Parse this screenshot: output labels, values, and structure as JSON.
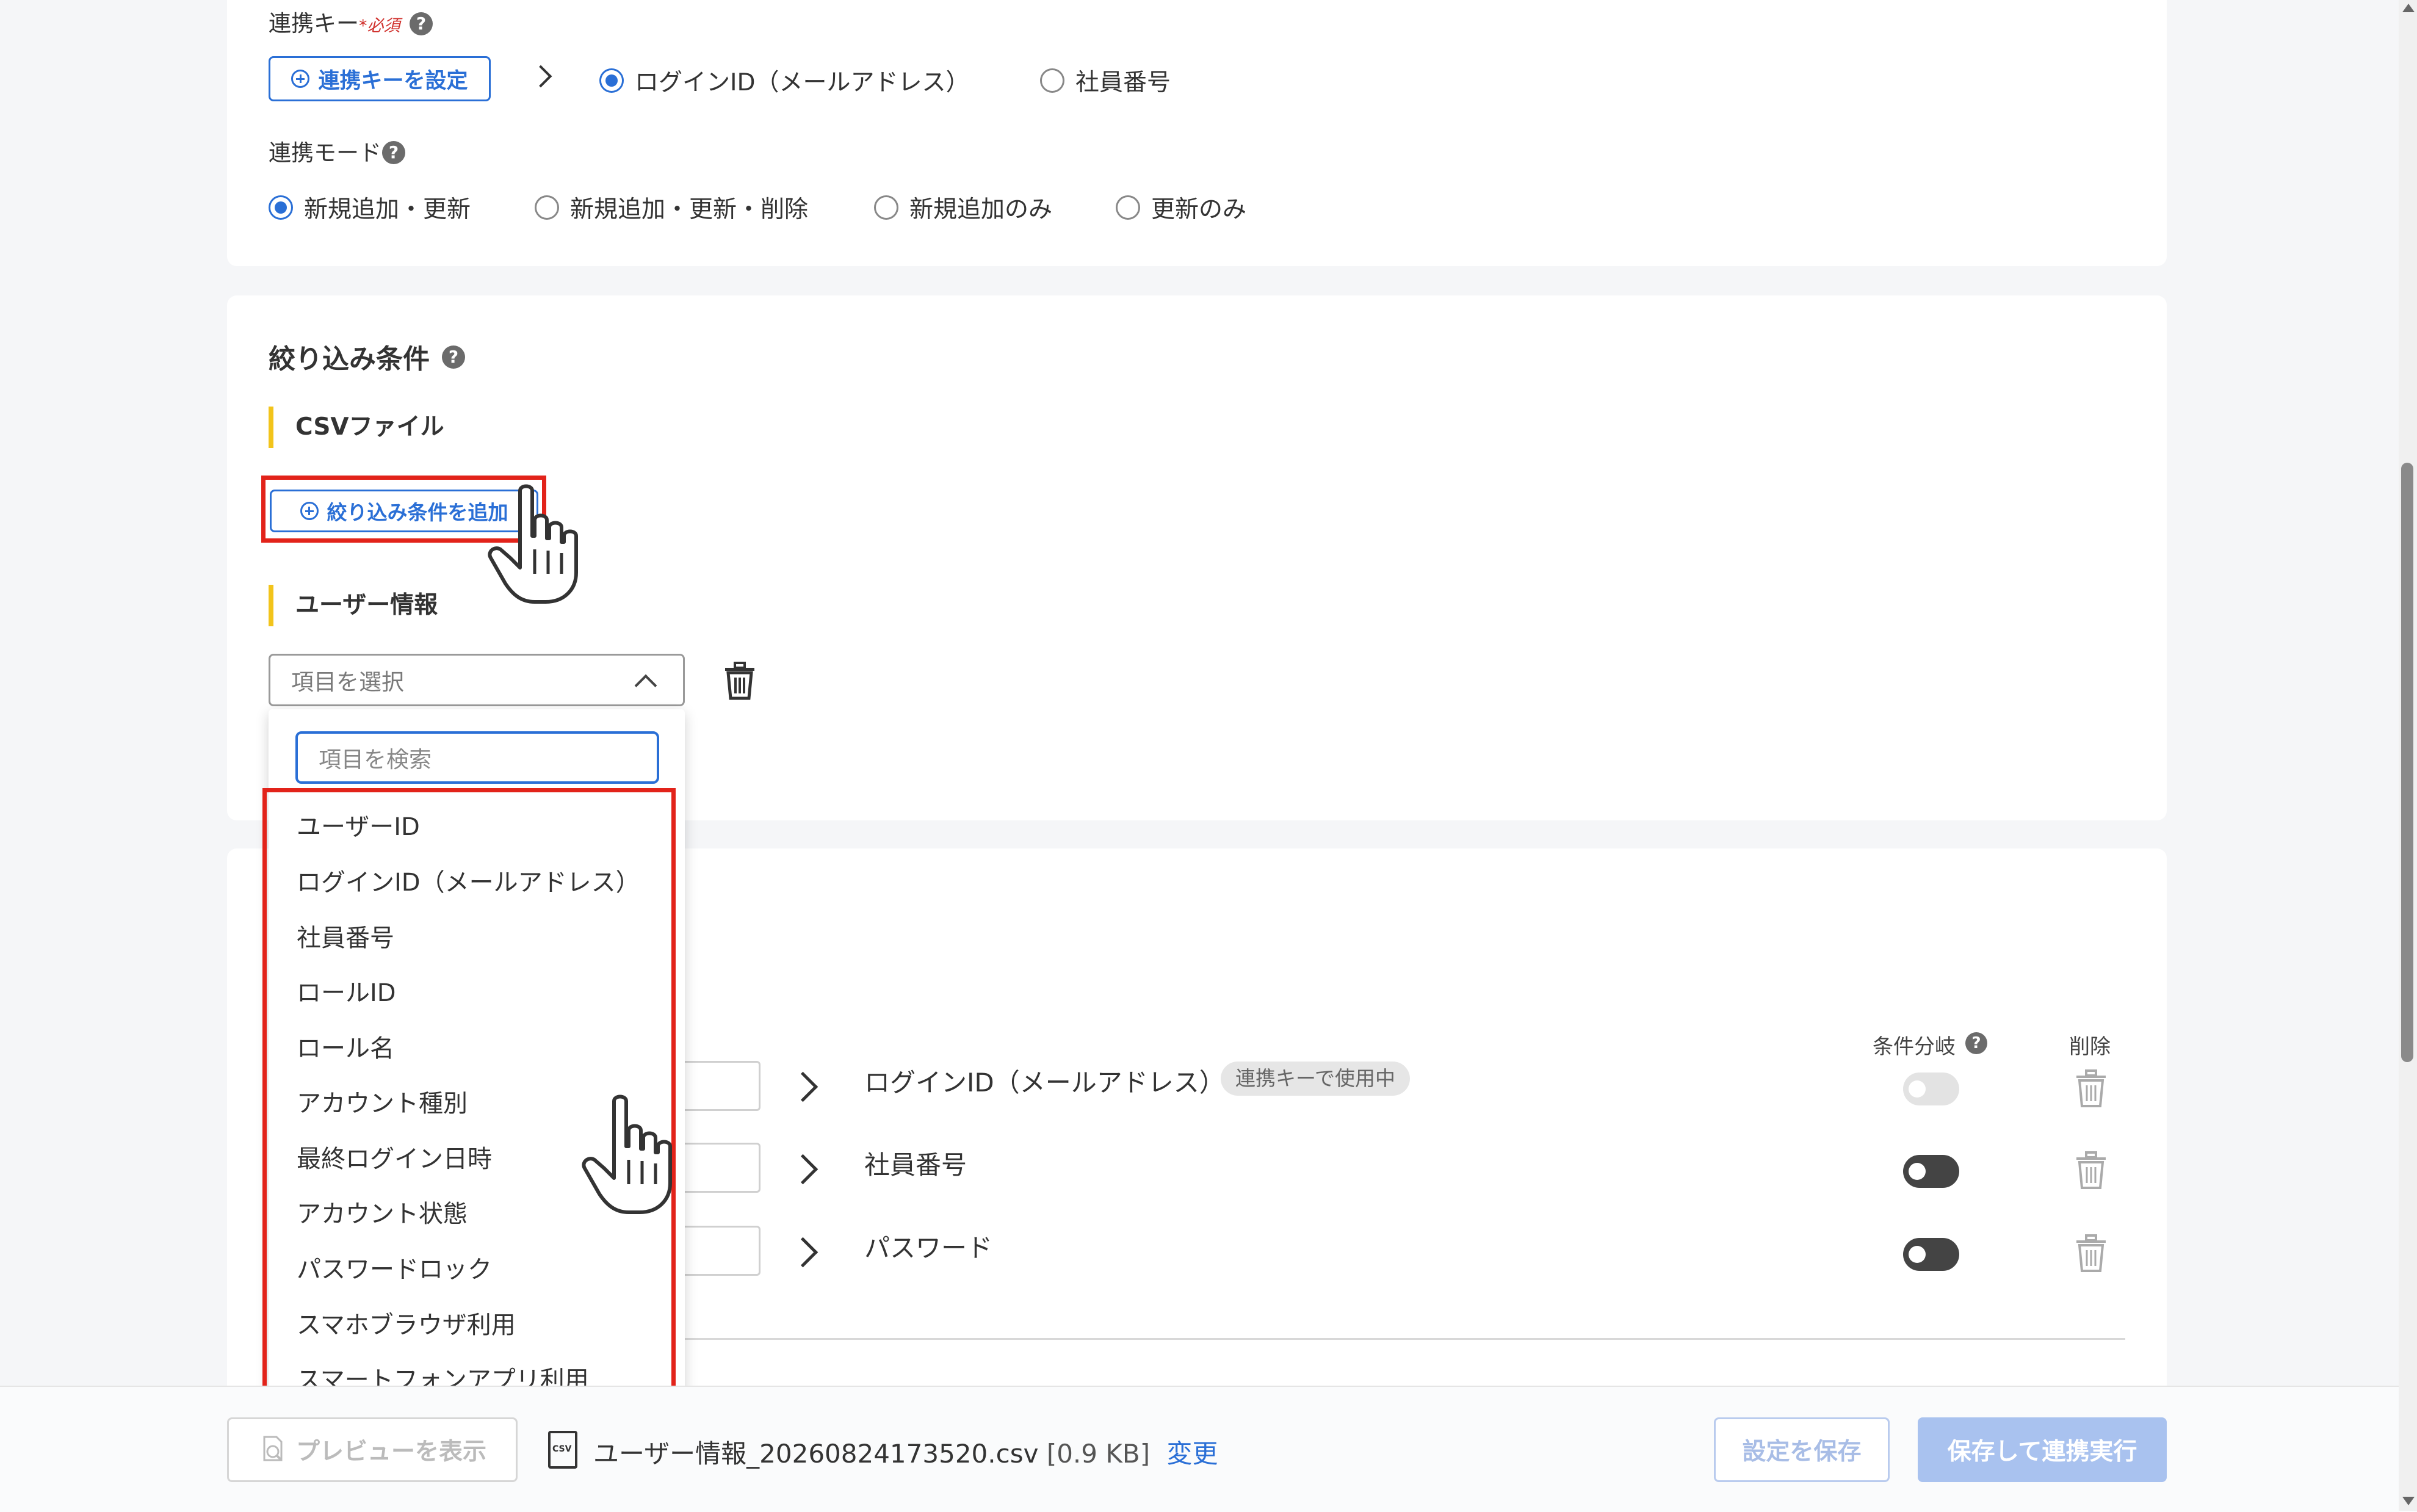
{
  "key_section": {
    "label": "連携キー",
    "required_mark": "*",
    "required_text": "必須",
    "help": "?",
    "set_key_button": "連携キーを設定",
    "options": [
      {
        "label": "ログインID（メールアドレス）",
        "selected": true
      },
      {
        "label": "社員番号",
        "selected": false
      }
    ]
  },
  "mode_section": {
    "label": "連携モード",
    "help": "?",
    "options": [
      {
        "label": "新規追加・更新",
        "selected": true
      },
      {
        "label": "新規追加・更新・削除",
        "selected": false
      },
      {
        "label": "新規追加のみ",
        "selected": false
      },
      {
        "label": "更新のみ",
        "selected": false
      }
    ]
  },
  "filter_section": {
    "title": "絞り込み条件",
    "help": "?",
    "csv_file_heading": "CSVファイル",
    "add_condition_button": "絞り込み条件を追加",
    "user_info_heading": "ユーザー情報",
    "select_placeholder": "項目を選択",
    "search_placeholder": "項目を検索",
    "dropdown_options": [
      "ユーザーID",
      "ログインID（メールアドレス）",
      "社員番号",
      "ロールID",
      "ロール名",
      "アカウント種別",
      "最終ログイン日時",
      "アカウント状態",
      "パスワードロック",
      "スマホブラウザ利用",
      "スマートフォンアプリ利用"
    ]
  },
  "mapping_section": {
    "col_condition_branch": "条件分岐",
    "help": "?",
    "col_delete": "削除",
    "rows": [
      {
        "target": "ログインID（メールアドレス）",
        "badge": "連携キーで使用中",
        "toggle_enabled": false
      },
      {
        "target": "社員番号",
        "badge": "",
        "toggle_enabled": true
      },
      {
        "target": "パスワード",
        "badge": "",
        "toggle_enabled": true
      }
    ]
  },
  "footer": {
    "preview_button": "プレビューを表示",
    "file_icon_text": "CSV",
    "file_name": "ユーザー情報_20260824173520.csv",
    "file_size": "[0.9 KB]",
    "change_link": "変更",
    "save_button": "設定を保存",
    "save_run_button": "保存して連携実行"
  },
  "colors": {
    "accent": "#2a6fd6",
    "highlight_red": "#e2231a",
    "section_bar": "#f2c41b"
  }
}
